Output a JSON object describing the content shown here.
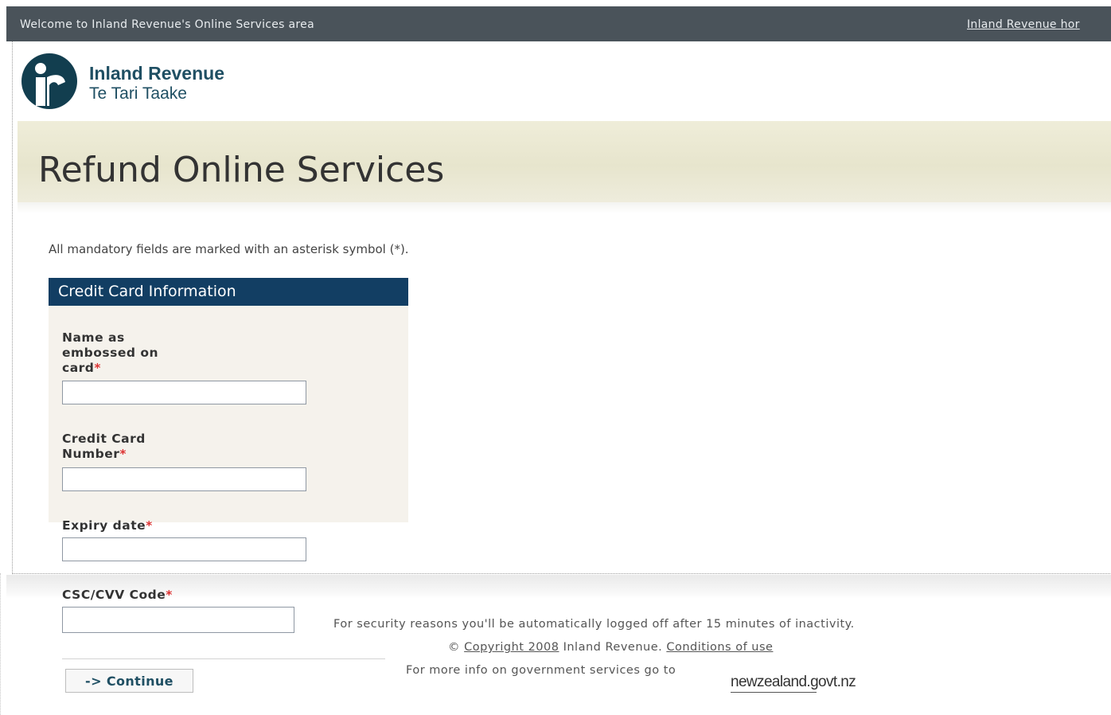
{
  "topbar": {
    "welcome": "Welcome to Inland Revenue's Online Services area",
    "home_link": "Inland Revenue hor"
  },
  "brand": {
    "name": "Inland Revenue",
    "maori_name": "Te Tari Taake",
    "logo_icon": "inland-revenue-ir-logo",
    "color": "#1f4f63"
  },
  "page": {
    "title": "Refund Online Services",
    "mandatory_note": "All mandatory fields are marked with an asterisk symbol (*)."
  },
  "form": {
    "header": "Credit Card Information",
    "header_color": "#123e63",
    "required_marker": "*",
    "fields": {
      "name": {
        "label_line1": "Name as",
        "label_line2": "embossed on",
        "label_line3": "card",
        "value": ""
      },
      "card_number": {
        "label_line1": "Credit Card",
        "label_line2": "Number",
        "value": ""
      },
      "expiry": {
        "label": "Expiry date",
        "value": ""
      },
      "csc": {
        "label": "CSC/CVV Code",
        "value": ""
      }
    },
    "continue_label": "-> Continue"
  },
  "footer": {
    "security_note": "For security reasons you'll be automatically logged off after 15 minutes of inactivity.",
    "copyright_symbol": "©",
    "copyright_link": "Copyright 2008",
    "copyright_text": "Inland Revenue.",
    "conditions_link": "Conditions of use",
    "govt_info": "For more info on government services go to",
    "govt_logo": "newzealand.govt.nz"
  }
}
